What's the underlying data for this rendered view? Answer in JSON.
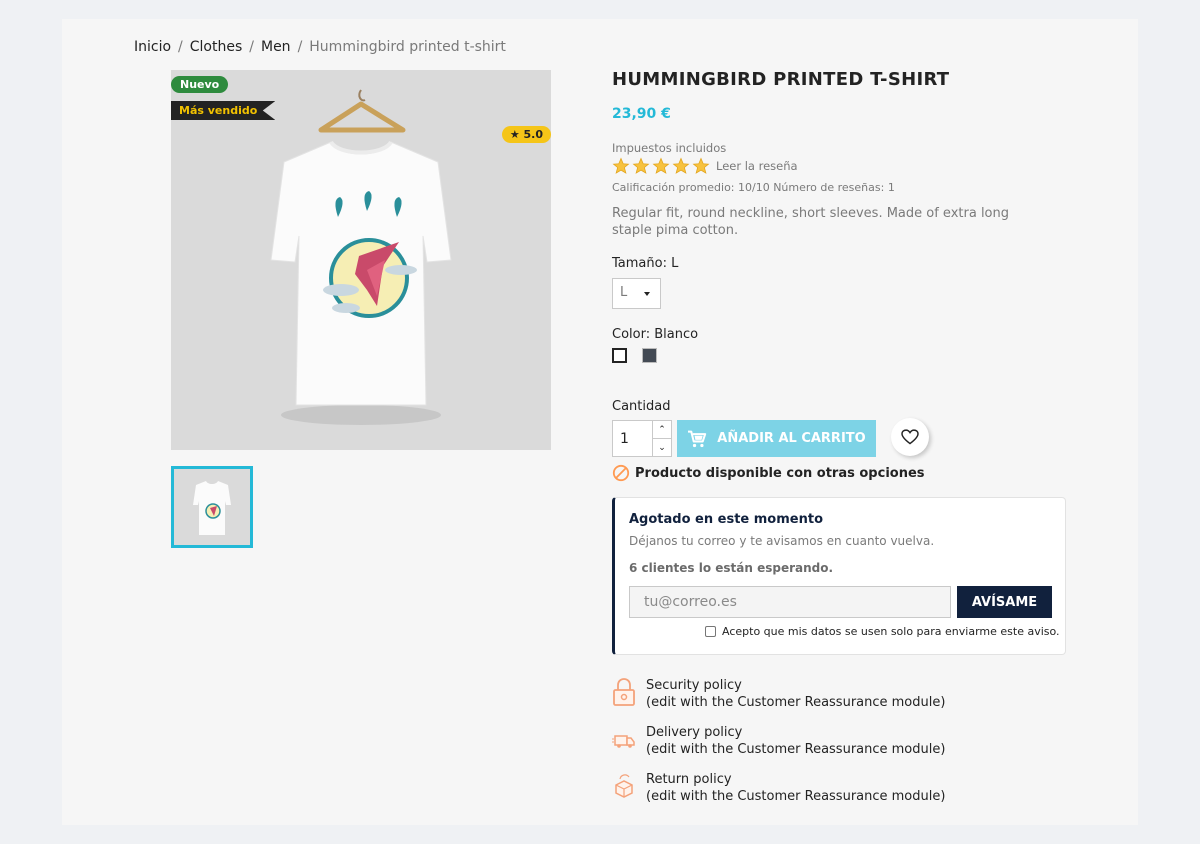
{
  "breadcrumb": [
    "Inicio",
    "Clothes",
    "Men",
    "Hummingbird printed t-shirt"
  ],
  "badges": {
    "new": "Nuevo",
    "bestseller": "Más vendido",
    "rating": "★ 5.0"
  },
  "product": {
    "title": "HUMMINGBIRD PRINTED T-SHIRT",
    "price": "23,90 €",
    "taxes": "Impuestos incluidos",
    "read_review": "Leer la reseña",
    "rating_summary": "Calificación promedio: 10/10 Número de reseñas: 1",
    "description": "Regular fit, round neckline, short sleeves. Made of extra long staple pima cotton."
  },
  "variants": {
    "size_label": "Tamaño: L",
    "size_value": "L",
    "color_label": "Color: Blanco",
    "colors": [
      "#ffffff",
      "#434a54"
    ]
  },
  "cart": {
    "quantity_label": "Cantidad",
    "quantity": "1",
    "add_label": "AÑADIR AL CARRITO",
    "availability": "Producto disponible con otras opciones"
  },
  "notify": {
    "heading": "Agotado en este momento",
    "subtext": "Déjanos tu correo y te avisamos en cuanto vuelva.",
    "waiting": "6 clientes lo están esperando.",
    "email_placeholder": "tu@correo.es",
    "button": "AVÍSAME",
    "consent": "Acepto que mis datos se usen solo para enviarme este aviso."
  },
  "reassurance": [
    {
      "title": "Security policy",
      "note": "(edit with the Customer Reassurance module)",
      "icon": "lock-icon"
    },
    {
      "title": "Delivery policy",
      "note": "(edit with the Customer Reassurance module)",
      "icon": "truck-icon"
    },
    {
      "title": "Return policy",
      "note": "(edit with the Customer Reassurance module)",
      "icon": "return-box-icon"
    }
  ]
}
